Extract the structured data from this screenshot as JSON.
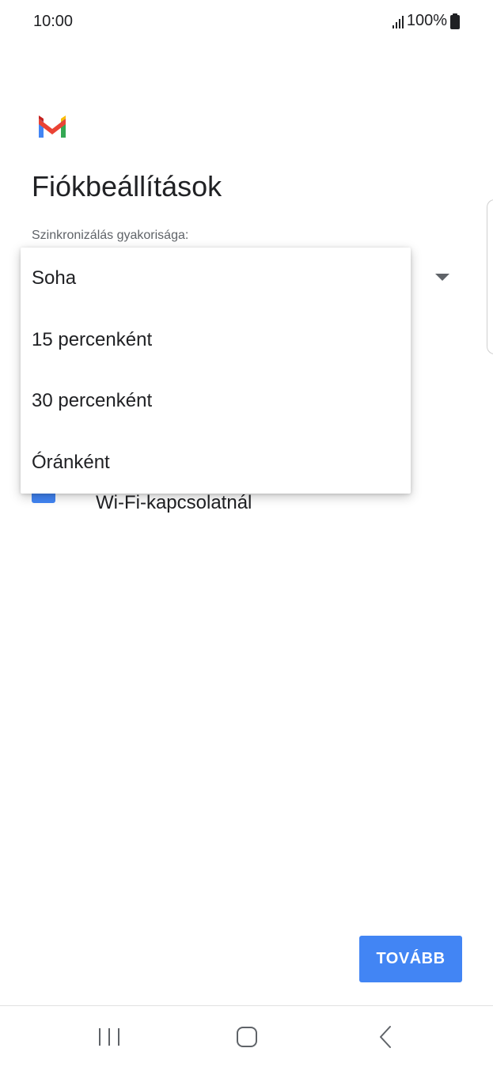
{
  "status_bar": {
    "time": "10:00",
    "battery": "100%",
    "signal_icon": "signal-bars-icon",
    "battery_icon": "battery-full-icon"
  },
  "app": {
    "logo_icon": "gmail-logo-icon",
    "title": "Fiókbeállítások"
  },
  "sync": {
    "label": "Szinkronizálás gyakorisága:",
    "dropdown_icon": "dropdown-arrow-icon",
    "options": [
      "Soha",
      "15 percenként",
      "30 percenként",
      "Óránként"
    ]
  },
  "wifi": {
    "label": "Wi-Fi-kapcsolatnál",
    "checked": true
  },
  "actions": {
    "next_label": "TOVÁBB"
  },
  "navigation": {
    "recent_icon": "recent-apps-icon",
    "home_icon": "home-icon",
    "back_icon": "back-icon"
  },
  "colors": {
    "accent": "#4285f4",
    "text_primary": "#202124",
    "text_secondary": "#5f6368"
  }
}
